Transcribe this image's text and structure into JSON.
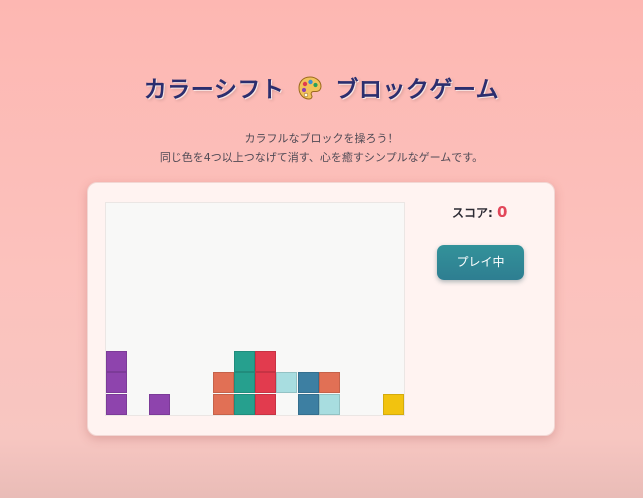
{
  "header": {
    "title_before": "カラーシフト",
    "title_icon": "palette-icon",
    "title_after": "ブロックゲーム",
    "subtitle_line1": "カラフルなブロックを操ろう！",
    "subtitle_line2": "同じ色を4つ以上つなげて消す、心を癒すシンプルなゲームです。"
  },
  "sidebar": {
    "score_label": "スコア:",
    "score_value": "0",
    "play_button_label": "プレイ中"
  },
  "colors": {
    "purple": "#8e44ad",
    "orange": "#e17055",
    "teal": "#26a08e",
    "red": "#e23b4e",
    "light_cyan": "#a8dde0",
    "steel_blue": "#3d7fa2",
    "yellow": "#f2c30f"
  },
  "board": {
    "columns": 14,
    "rows": 10,
    "blocks": [
      {
        "col": 0,
        "row": 7,
        "color": "purple"
      },
      {
        "col": 0,
        "row": 8,
        "color": "purple"
      },
      {
        "col": 0,
        "row": 9,
        "color": "purple"
      },
      {
        "col": 2,
        "row": 9,
        "color": "purple"
      },
      {
        "col": 5,
        "row": 8,
        "color": "orange"
      },
      {
        "col": 5,
        "row": 9,
        "color": "orange"
      },
      {
        "col": 6,
        "row": 7,
        "color": "teal"
      },
      {
        "col": 6,
        "row": 8,
        "color": "teal"
      },
      {
        "col": 6,
        "row": 9,
        "color": "teal"
      },
      {
        "col": 7,
        "row": 7,
        "color": "red"
      },
      {
        "col": 7,
        "row": 8,
        "color": "red"
      },
      {
        "col": 7,
        "row": 9,
        "color": "red"
      },
      {
        "col": 8,
        "row": 8,
        "color": "light_cyan"
      },
      {
        "col": 9,
        "row": 8,
        "color": "steel_blue"
      },
      {
        "col": 9,
        "row": 9,
        "color": "steel_blue"
      },
      {
        "col": 10,
        "row": 8,
        "color": "orange"
      },
      {
        "col": 10,
        "row": 9,
        "color": "light_cyan"
      },
      {
        "col": 13,
        "row": 9,
        "color": "yellow"
      }
    ]
  }
}
